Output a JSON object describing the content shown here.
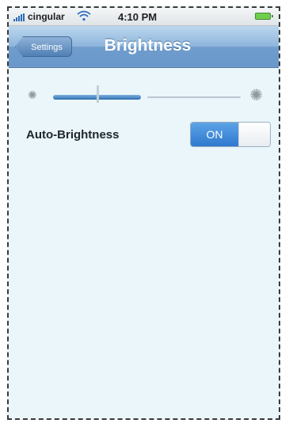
{
  "status_bar": {
    "carrier": "cingular",
    "time": "4:10 PM",
    "icons": [
      "signal-icon",
      "wifi-icon",
      "battery-icon"
    ]
  },
  "nav": {
    "back_label": "Settings",
    "title": "Brightness"
  },
  "brightness": {
    "level": 0.47,
    "min_icon": "sun-small-icon",
    "max_icon": "sun-large-icon"
  },
  "auto_brightness": {
    "label": "Auto-Brightness",
    "state_label": "ON",
    "enabled": true
  },
  "colors": {
    "accent": "#2f79cf",
    "nav_bar": "#8fb6dc",
    "background": "#eaf6fa"
  }
}
